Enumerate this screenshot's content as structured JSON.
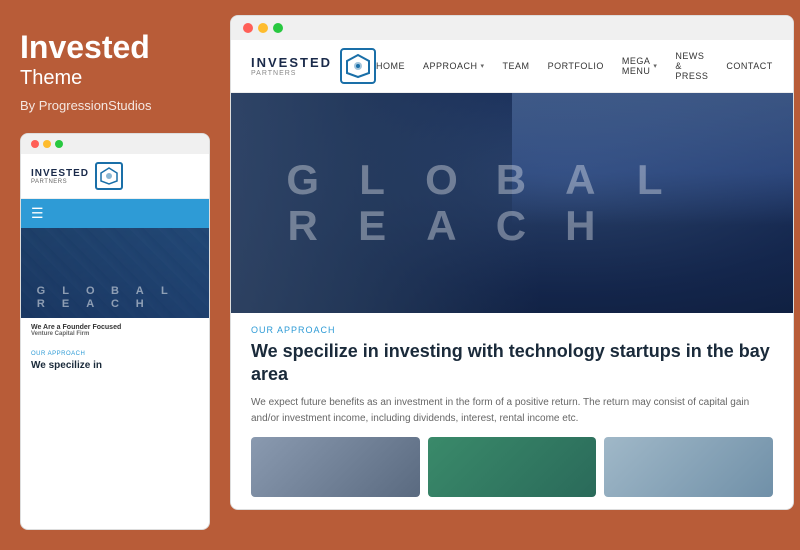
{
  "sidebar": {
    "theme_name": "Invested",
    "theme_label": "Theme",
    "by_text": "By ProgressionStudios"
  },
  "mobile_preview": {
    "dots": [
      "red",
      "yellow",
      "green"
    ],
    "logo_text": "INVESTED",
    "logo_sub": "PARTNERS",
    "nav_icon": "☰",
    "hero_row1": [
      "G",
      "L",
      "O",
      "B",
      "A",
      "L",
      ""
    ],
    "hero_row2": [
      "R",
      "E",
      "A",
      "C",
      "H",
      "",
      ""
    ],
    "tagline": "We Are a Founder Focused",
    "tagline_sub": "Venture Capital Firm",
    "approach_label": "OUR APPROACH",
    "approach_title": "We specilize in"
  },
  "desktop_preview": {
    "dots": [
      "red",
      "yellow",
      "green"
    ],
    "logo_text": "INVESTED",
    "logo_sub": "PARTNERS",
    "nav_items": [
      {
        "label": "HOME",
        "has_arrow": false
      },
      {
        "label": "APPROACH",
        "has_arrow": true
      },
      {
        "label": "TEAM",
        "has_arrow": false
      },
      {
        "label": "PORTFOLIO",
        "has_arrow": false
      },
      {
        "label": "MEGA MENU",
        "has_arrow": true
      },
      {
        "label": "NEWS & PRESS",
        "has_arrow": false
      },
      {
        "label": "CONTACT",
        "has_arrow": false
      }
    ],
    "hero_row1": [
      "G",
      "L",
      "O",
      "B",
      "A",
      "L",
      ""
    ],
    "hero_row2": [
      "R",
      "E",
      "A",
      "C",
      "H",
      "",
      ""
    ],
    "approach_label": "OUR APPROACH",
    "approach_title": "We specilize in investing with technology startups in the bay area",
    "approach_body": "We expect future benefits as an investment in the form of a positive return. The return may consist of capital gain and/or investment income, including dividends, interest, rental income etc.",
    "images": [
      {
        "label": "image-1",
        "style": "dark-mountain"
      },
      {
        "label": "image-2",
        "style": "teal"
      },
      {
        "label": "image-3",
        "style": "light-blue"
      }
    ]
  },
  "colors": {
    "sidebar_bg": "#b85c38",
    "accent_blue": "#2e9bd6",
    "dark_navy": "#1a2a4a"
  }
}
